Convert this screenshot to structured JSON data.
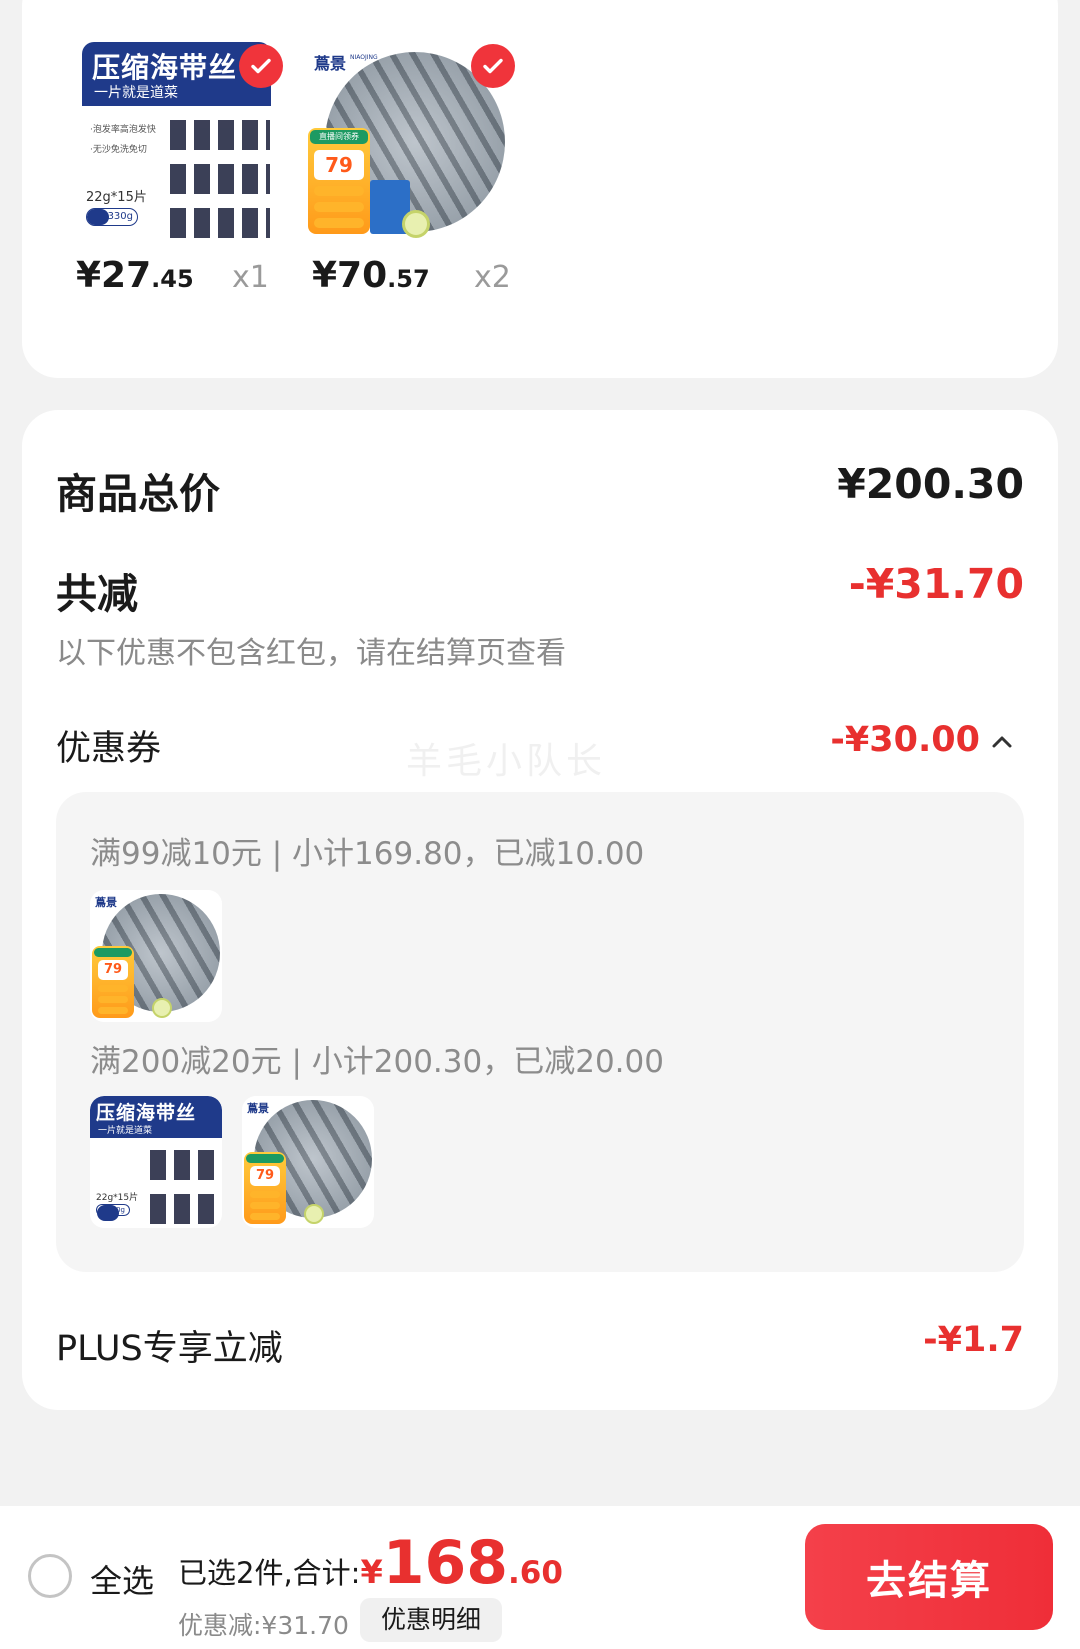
{
  "products": [
    {
      "name": "kelp",
      "thumb_title": "压缩海带丝",
      "thumb_subtitle": "一片就是道菜",
      "thumb_bullets": [
        "·泡发率高泡发快",
        "·无沙免洗免切"
      ],
      "thumb_spec": "22g*15片",
      "thumb_net": "330g",
      "price_int": "¥27",
      "price_dec": ".45",
      "qty": "x1",
      "selected": true
    },
    {
      "name": "shrimp",
      "thumb_brand": "蔦景",
      "thumb_brand_sub": "NIAOJING",
      "thumb_tag": "直播间领券",
      "thumb_tag_price": "79",
      "price_int": "¥70",
      "price_dec": ".57",
      "qty": "x2",
      "selected": true
    }
  ],
  "summary": {
    "total_label": "商品总价",
    "total_value": "¥200.30",
    "reduce_label": "共减",
    "reduce_value": "-¥31.70",
    "hint": "以下优惠不包含红包，请在结算页查看",
    "coupon_label": "优惠券",
    "coupon_value": "-¥30.00",
    "watermark": "羊毛小队长",
    "coupons": [
      {
        "rule": "满99减10元 | 小计169.80，已减10.00"
      },
      {
        "rule": "满200减20元 | 小计200.30，已减20.00"
      }
    ],
    "plus_label": "PLUS专享立减",
    "plus_value": "-¥1.7"
  },
  "bottom_bar": {
    "select_all": "全选",
    "selected_text": "已选2件,合计:",
    "currency": "¥",
    "total_int": "168",
    "total_dec": ".60",
    "discount_text": "优惠减:¥31.70",
    "detail_button": "优惠明细",
    "checkout_button": "去结算"
  },
  "colors": {
    "accent_red": "#e8302f",
    "checkout_red": "#ef2e38",
    "page_bg": "#f2f2f2"
  }
}
